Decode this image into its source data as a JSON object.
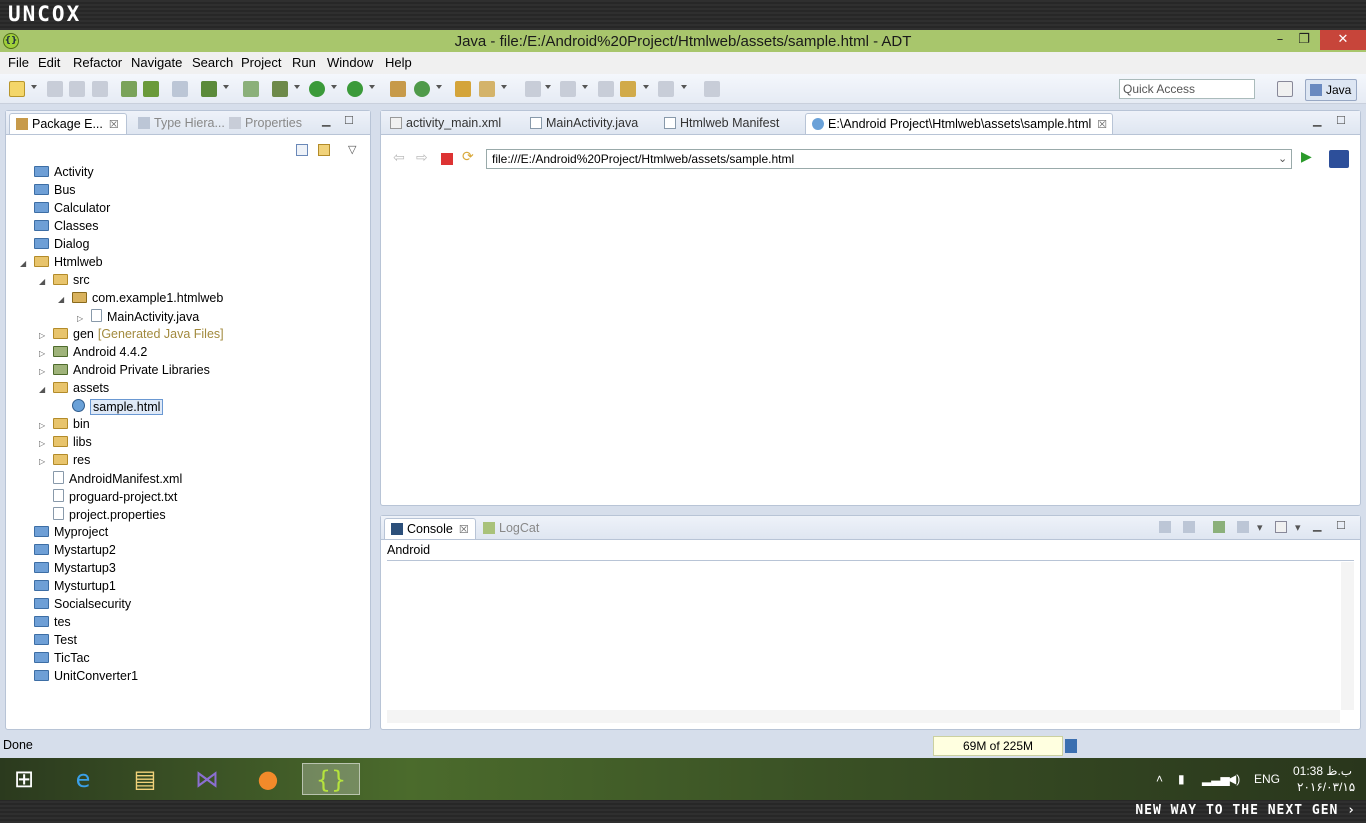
{
  "brand": {
    "logo": "UNCOX",
    "slogan": "NEW WAY TO THE NEXT GEN ›"
  },
  "window": {
    "title": "Java - file:/E:/Android%20Project/Htmlweb/assets/sample.html - ADT",
    "minimize": "–",
    "maximize": "❐",
    "close": "✕"
  },
  "menu": [
    "File",
    "Edit",
    "Refactor",
    "Navigate",
    "Search",
    "Project",
    "Run",
    "Window",
    "Help"
  ],
  "toolbar": {
    "quick_access_placeholder": "Quick Access",
    "perspective": "Java"
  },
  "left_panel": {
    "tabs": [
      {
        "label": "Package E...",
        "close": "☒"
      },
      {
        "label": "Type Hiera..."
      },
      {
        "label": "Properties"
      }
    ],
    "tree": [
      {
        "label": "Activity",
        "level": 0,
        "kind": "proj",
        "toggle": ""
      },
      {
        "label": "Bus",
        "level": 0,
        "kind": "proj",
        "toggle": ""
      },
      {
        "label": "Calculator",
        "level": 0,
        "kind": "proj",
        "toggle": ""
      },
      {
        "label": "Classes",
        "level": 0,
        "kind": "proj",
        "toggle": ""
      },
      {
        "label": "Dialog",
        "level": 0,
        "kind": "proj",
        "toggle": ""
      },
      {
        "label": "Htmlweb",
        "level": 0,
        "kind": "src",
        "toggle": "◢"
      },
      {
        "label": "src",
        "level": 1,
        "kind": "src",
        "toggle": "◢"
      },
      {
        "label": "com.example1.htmlweb",
        "level": 2,
        "kind": "pkg",
        "toggle": "◢"
      },
      {
        "label": "MainActivity.java",
        "level": 3,
        "kind": "file",
        "toggle": "▷"
      },
      {
        "label": "gen",
        "hint": "[Generated Java Files]",
        "level": 1,
        "kind": "src",
        "toggle": "▷"
      },
      {
        "label": "Android 4.4.2",
        "level": 1,
        "kind": "lib",
        "toggle": "▷"
      },
      {
        "label": "Android Private Libraries",
        "level": 1,
        "kind": "lib",
        "toggle": "▷"
      },
      {
        "label": "assets",
        "level": 1,
        "kind": "src",
        "toggle": "◢"
      },
      {
        "label": "sample.html",
        "level": 2,
        "kind": "web",
        "toggle": "",
        "selected": true
      },
      {
        "label": "bin",
        "level": 1,
        "kind": "src",
        "toggle": "▷"
      },
      {
        "label": "libs",
        "level": 1,
        "kind": "src",
        "toggle": "▷"
      },
      {
        "label": "res",
        "level": 1,
        "kind": "src",
        "toggle": "▷"
      },
      {
        "label": "AndroidManifest.xml",
        "level": 1,
        "kind": "file",
        "toggle": ""
      },
      {
        "label": "proguard-project.txt",
        "level": 1,
        "kind": "file",
        "toggle": ""
      },
      {
        "label": "project.properties",
        "level": 1,
        "kind": "file",
        "toggle": ""
      },
      {
        "label": "Myproject",
        "level": 0,
        "kind": "proj",
        "toggle": ""
      },
      {
        "label": "Mystartup2",
        "level": 0,
        "kind": "proj",
        "toggle": ""
      },
      {
        "label": "Mystartup3",
        "level": 0,
        "kind": "proj",
        "toggle": ""
      },
      {
        "label": "Mysturtup1",
        "level": 0,
        "kind": "proj",
        "toggle": ""
      },
      {
        "label": "Socialsecurity",
        "level": 0,
        "kind": "proj",
        "toggle": ""
      },
      {
        "label": "tes",
        "level": 0,
        "kind": "proj",
        "toggle": ""
      },
      {
        "label": "Test",
        "level": 0,
        "kind": "proj",
        "toggle": ""
      },
      {
        "label": "TicTac",
        "level": 0,
        "kind": "proj",
        "toggle": ""
      },
      {
        "label": "UnitConverter1",
        "level": 0,
        "kind": "proj",
        "toggle": ""
      }
    ]
  },
  "editor": {
    "tabs": [
      {
        "label": "activity_main.xml"
      },
      {
        "label": "MainActivity.java"
      },
      {
        "label": "Htmlweb Manifest"
      },
      {
        "label": "E:\\Android Project\\Htmlweb\\assets\\sample.html",
        "close": "☒"
      }
    ],
    "url": "file:///E:/Android%20Project/Htmlweb/assets/sample.html"
  },
  "console": {
    "tabs": [
      {
        "label": "Console",
        "close": "☒"
      },
      {
        "label": "LogCat"
      }
    ],
    "title": "Android"
  },
  "status": {
    "text": "Done",
    "heap": "69M of 225M"
  },
  "taskbar": {
    "lang": "ENG",
    "time": "01:38 ب.ظ",
    "date": "۲۰۱۶/۰۳/۱۵"
  }
}
